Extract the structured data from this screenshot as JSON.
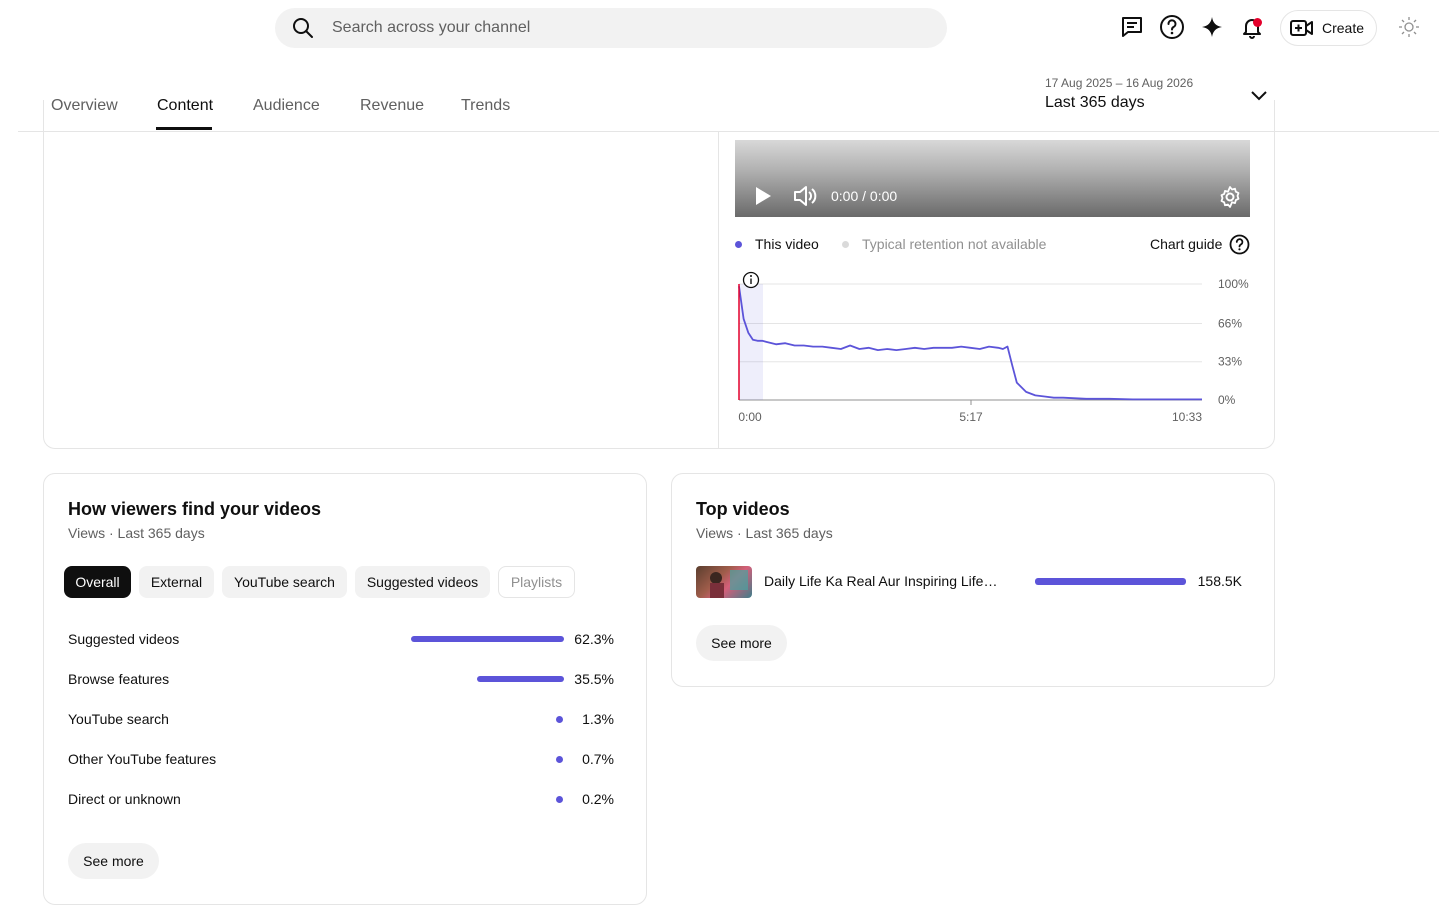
{
  "header": {
    "search": {
      "placeholder": "Search across your channel"
    },
    "create_label": "Create",
    "icons": [
      "search-icon",
      "feedback-icon",
      "help-icon",
      "sparkle-icon",
      "bell-icon",
      "create-video-icon",
      "theme-icon"
    ],
    "accent_color": "#5c54d9",
    "notification_dot_color": "#e4002b"
  },
  "tabs": [
    {
      "label": "Overview",
      "active": false
    },
    {
      "label": "Content",
      "active": true
    },
    {
      "label": "Audience",
      "active": false
    },
    {
      "label": "Revenue",
      "active": false
    },
    {
      "label": "Trends",
      "active": false
    }
  ],
  "date_range": {
    "range": "17 Aug 2025 – 16 Aug 2026",
    "label": "Last 365 days"
  },
  "retention": {
    "player_time": "0:00 / 0:00",
    "legend": [
      {
        "label": "This video",
        "color": "#5c54d9"
      },
      {
        "label": "Typical retention not available",
        "color": "#dadada"
      }
    ],
    "chart_guide_label": "Chart guide",
    "chart_data": {
      "type": "line",
      "x_ticks": [
        "0:00",
        "5:17",
        "10:33"
      ],
      "y_ticks": [
        "100%",
        "66%",
        "33%",
        "0%"
      ],
      "ylim": [
        0,
        100
      ],
      "series": [
        {
          "name": "This video",
          "color": "#5c54d9",
          "x": [
            0,
            1,
            2,
            3,
            4,
            5,
            6,
            8,
            10,
            12,
            14,
            16,
            18,
            20,
            22,
            24,
            26,
            28,
            30,
            32,
            34,
            36,
            38,
            40,
            42,
            44,
            46,
            48,
            50,
            52,
            54,
            56,
            57,
            58,
            59,
            60,
            62,
            64,
            66,
            68,
            70,
            75,
            80,
            85,
            90,
            95,
            100
          ],
          "y": [
            98,
            70,
            58,
            52,
            51,
            51,
            50,
            48,
            49,
            47,
            47,
            46,
            46,
            45,
            44,
            47,
            44,
            45,
            43,
            44,
            43,
            44,
            45,
            44,
            45,
            45,
            45,
            46,
            45,
            44,
            46,
            45,
            44,
            46,
            30,
            15,
            7,
            4,
            3,
            2,
            2,
            1,
            1,
            0.5,
            0.5,
            0.5,
            0.5
          ]
        }
      ]
    }
  },
  "traffic": {
    "title": "How viewers find your videos",
    "subtitle": "Views · Last 365 days",
    "chips": [
      {
        "label": "Overall",
        "state": "active"
      },
      {
        "label": "External",
        "state": "normal"
      },
      {
        "label": "YouTube search",
        "state": "normal"
      },
      {
        "label": "Suggested videos",
        "state": "normal"
      },
      {
        "label": "Playlists",
        "state": "disabled"
      }
    ],
    "sources": [
      {
        "label": "Suggested videos",
        "value": "62.3%",
        "fraction": 0.623
      },
      {
        "label": "Browse features",
        "value": "35.5%",
        "fraction": 0.355
      },
      {
        "label": "YouTube search",
        "value": "1.3%",
        "fraction": 0.013
      },
      {
        "label": "Other YouTube features",
        "value": "0.7%",
        "fraction": 0.007
      },
      {
        "label": "Direct or unknown",
        "value": "0.2%",
        "fraction": 0.002
      }
    ],
    "see_more_label": "See more"
  },
  "top_videos": {
    "title": "Top videos",
    "subtitle": "Views · Last 365 days",
    "items": [
      {
        "title": "Daily Life Ka Real Aur Inspiring Lifestyle",
        "value": "158.5K",
        "fraction": 1.0
      }
    ],
    "see_more_label": "See more"
  }
}
